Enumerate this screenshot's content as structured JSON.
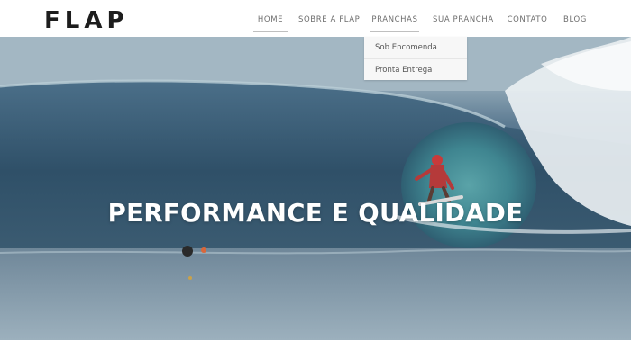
{
  "header": {
    "logo": "FLAP"
  },
  "nav": {
    "items": [
      {
        "label": "HOME",
        "active": true
      },
      {
        "label": "SOBRE A FLAP",
        "active": false
      },
      {
        "label": "PRANCHAS",
        "active": true
      },
      {
        "label": "SUA PRANCHA",
        "active": false
      },
      {
        "label": "CONTATO",
        "active": false
      },
      {
        "label": "BLOG",
        "active": false
      }
    ]
  },
  "dropdown": {
    "items": [
      {
        "label": "Sob Encomenda"
      },
      {
        "label": "Pronta Entrega"
      }
    ]
  },
  "hero": {
    "title": "PERFORMANCE E QUALIDADE"
  },
  "colors": {
    "logo": "#1d1d1d",
    "nav_text": "#6d6d6d",
    "nav_active_underline": "#bfbfbf",
    "dropdown_bg": "#f7f7f7",
    "hero_title": "#ffffff",
    "wave_dark": "#2f5068",
    "sea": "#8ea4b3"
  }
}
